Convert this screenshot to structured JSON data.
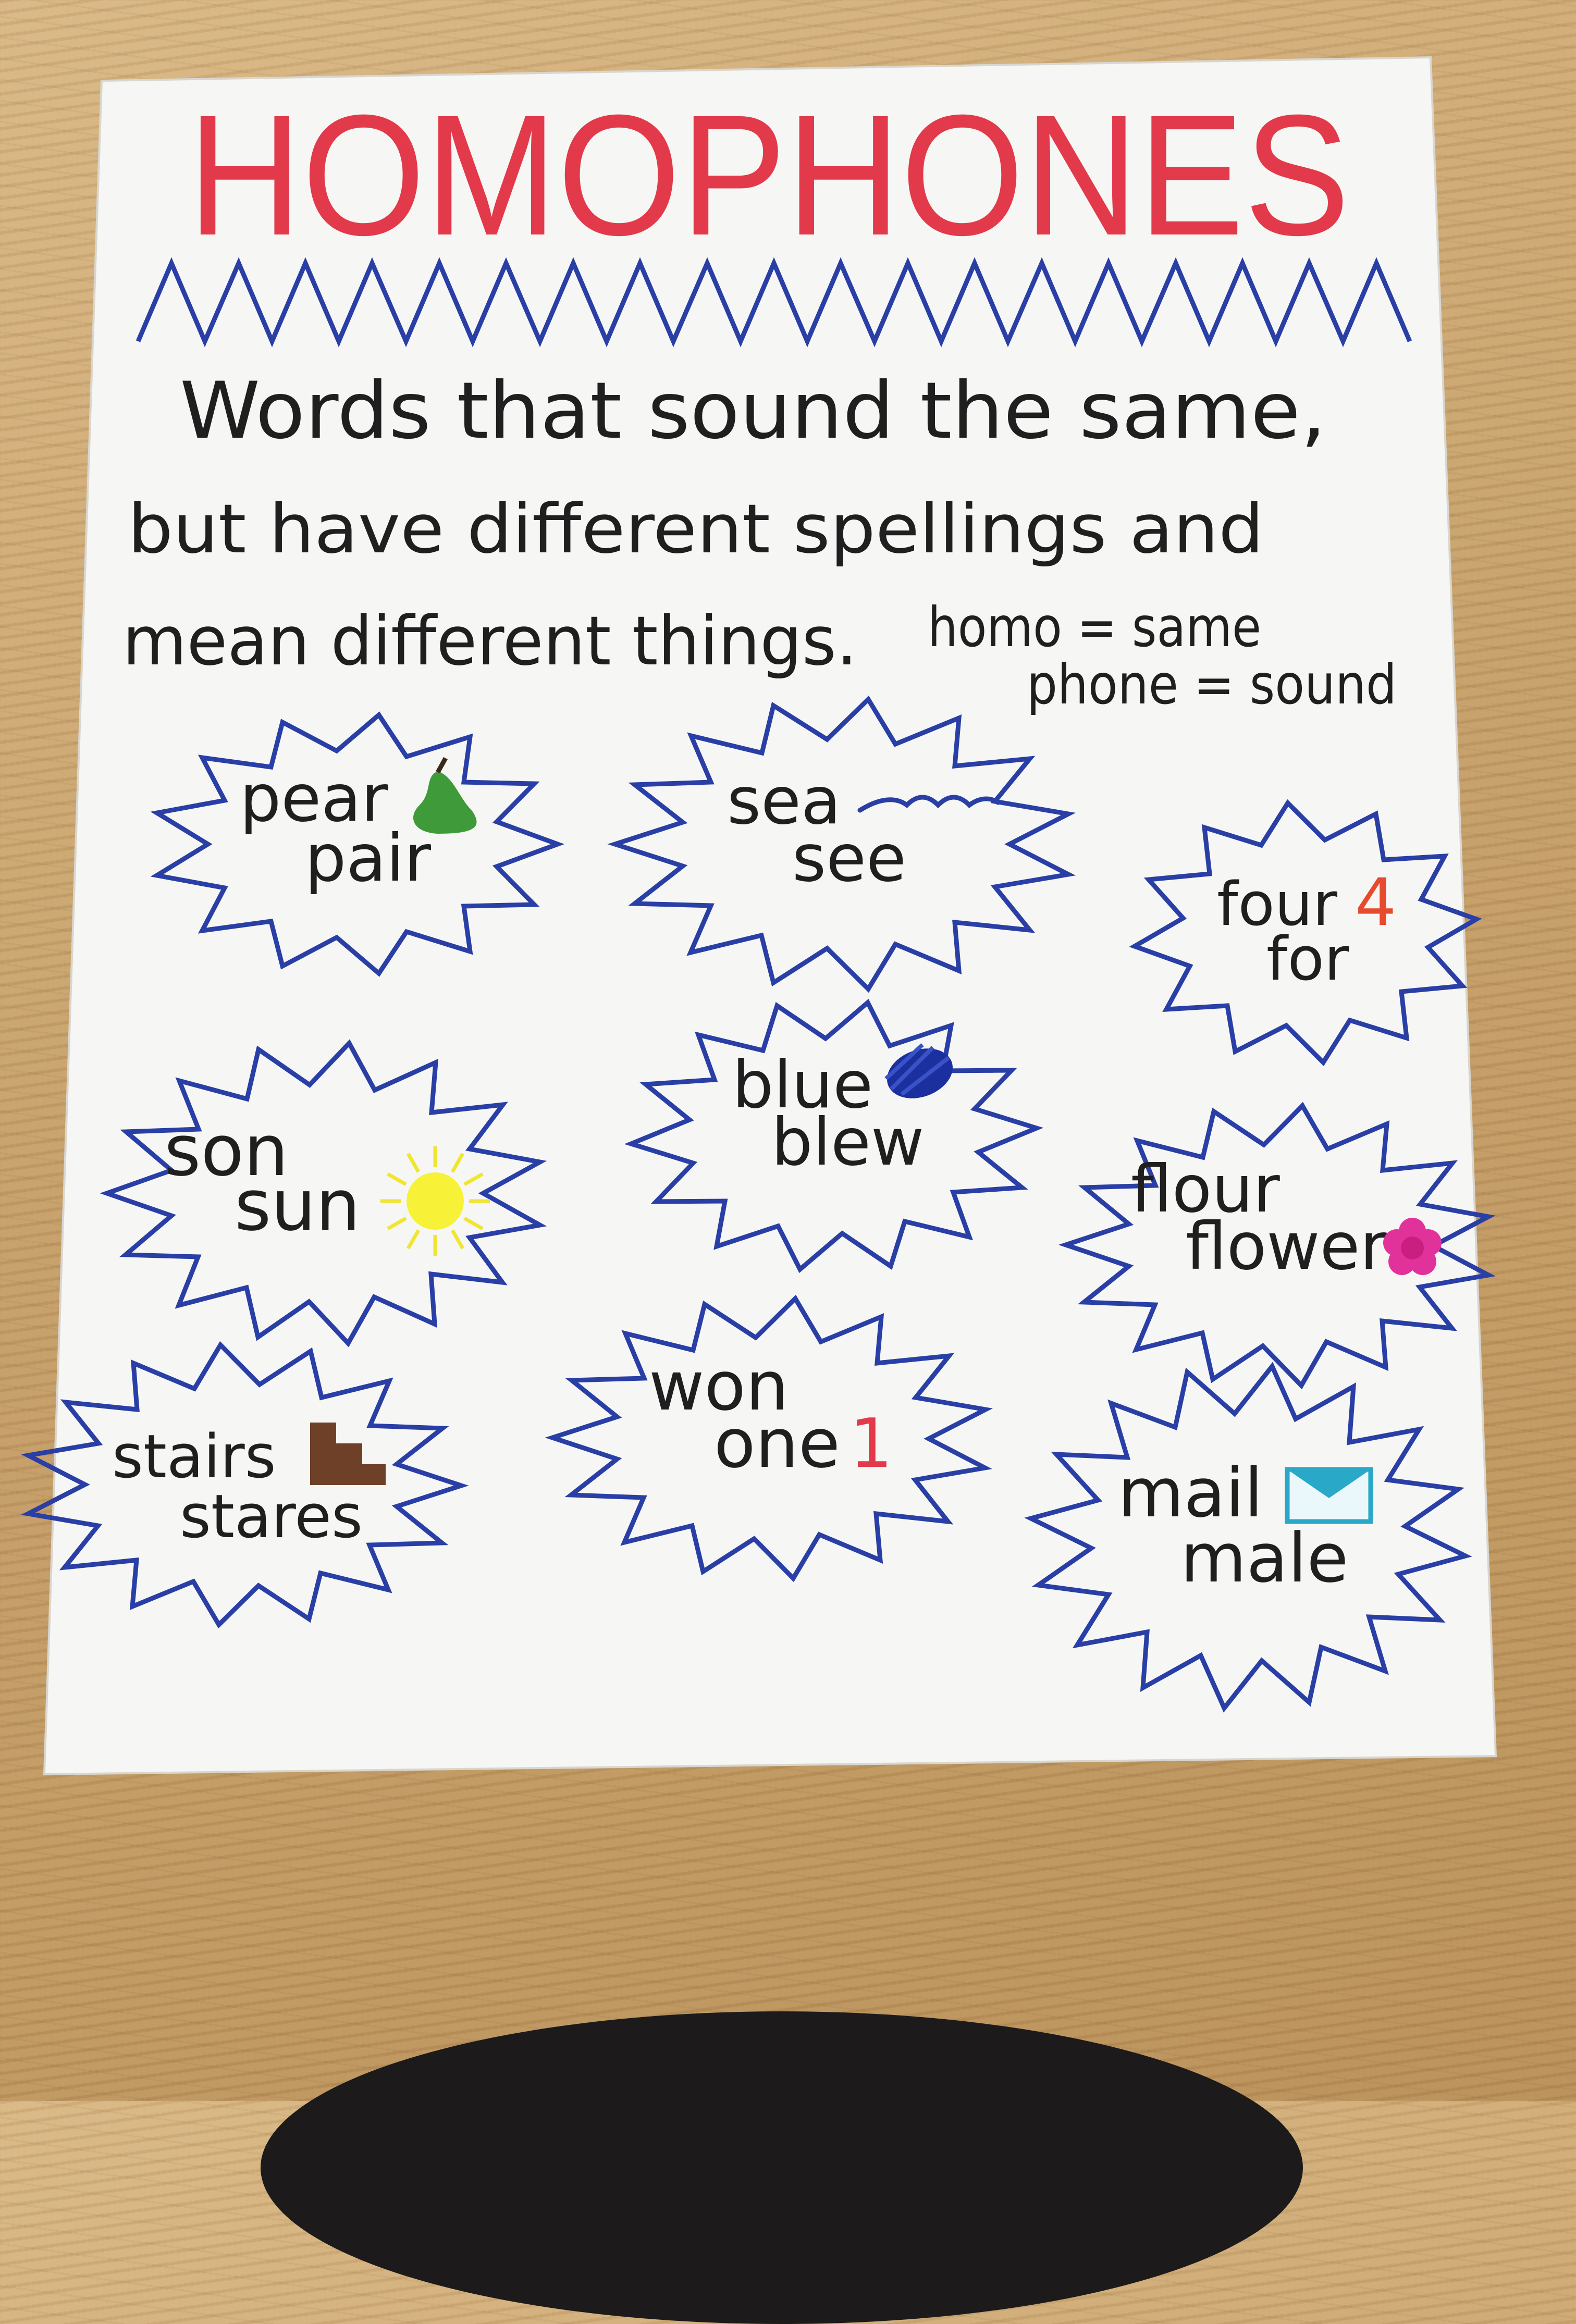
{
  "poster": {
    "title": "HOMOPHONES",
    "definition_lines": [
      "Words that sound the same,",
      "but have different spellings and",
      "mean different things."
    ],
    "roots": [
      "homo = same",
      "phone = sound"
    ]
  },
  "bursts": [
    {
      "word1": "pear",
      "word2": "pair",
      "icon": "pear-icon"
    },
    {
      "word1": "sea",
      "word2": "see",
      "icon": "wave-icon"
    },
    {
      "word1": "four",
      "word2": "for",
      "icon": "number-4-icon",
      "icon_text": "4"
    },
    {
      "word1": "son",
      "word2": "sun",
      "icon": "sun-icon"
    },
    {
      "word1": "blue",
      "word2": "blew",
      "icon": "blue-scribble-icon"
    },
    {
      "word1": "flour",
      "word2": "flower",
      "icon": "flower-icon"
    },
    {
      "word1": "stairs",
      "word2": "stares",
      "icon": "stairs-icon"
    },
    {
      "word1": "won",
      "word2": "one",
      "icon": "number-1-icon",
      "icon_text": "1"
    },
    {
      "word1": "mail",
      "word2": "male",
      "icon": "envelope-icon"
    }
  ],
  "colors": {
    "title": "#e23a4a",
    "burst_outline": "#2a3fa6",
    "pear": "#3f9a3a",
    "sun": "#f7f238",
    "blue_scribble": "#1b2f9e",
    "flower": "#e0329a",
    "stairs": "#6e4028",
    "number": "#e84a2e",
    "envelope": "#2aa8c8"
  }
}
